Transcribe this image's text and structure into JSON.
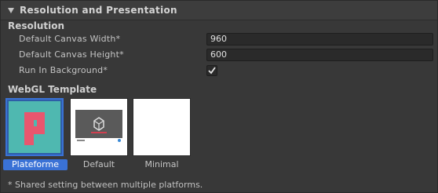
{
  "foldout": {
    "title": "Resolution and Presentation"
  },
  "resolution": {
    "heading": "Resolution",
    "width_label": "Default Canvas Width*",
    "width_value": "960",
    "height_label": "Default Canvas Height*",
    "height_value": "600",
    "run_bg_label": "Run In Background*",
    "run_bg_checked": true
  },
  "webgl": {
    "heading": "WebGL Template",
    "templates": [
      {
        "label": "Plateforme",
        "selected": true,
        "thumb_letter": "P"
      },
      {
        "label": "Default",
        "selected": false
      },
      {
        "label": "Minimal",
        "selected": false
      }
    ]
  },
  "footnote": "* Shared setting between multiple platforms.",
  "colors": {
    "selection": "#3a72d6",
    "plateforme_bg": "#4fb8b0",
    "plateforme_letter": "#e8566e"
  }
}
